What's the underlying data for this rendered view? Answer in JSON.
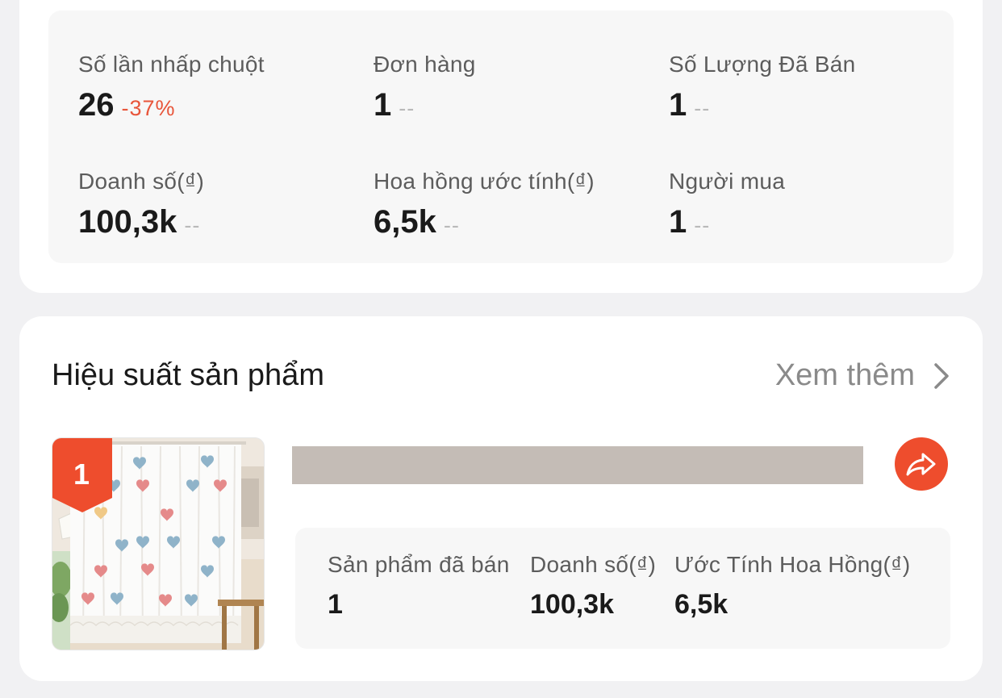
{
  "stats": [
    {
      "label": "Số lần nhấp chuột",
      "value": "26",
      "change": "-37%"
    },
    {
      "label": "Đơn hàng",
      "value": "1",
      "change": "--"
    },
    {
      "label": "Số Lượng Đã Bán",
      "value": "1",
      "change": "--"
    },
    {
      "label": "Doanh số(₫)",
      "value": "100,3k",
      "change": "--"
    },
    {
      "label": "Hoa hồng ước tính(₫)",
      "value": "6,5k",
      "change": "--"
    },
    {
      "label": "Người mua",
      "value": "1",
      "change": "--"
    }
  ],
  "product_section": {
    "title": "Hiệu suất sản phẩm",
    "see_more": "Xem thêm",
    "see_more_icon": "chevron-right-icon",
    "product": {
      "rank": "1",
      "share_icon": "share-icon",
      "metrics": [
        {
          "label": "Sản phẩm đã bán",
          "value": "1"
        },
        {
          "label": "Doanh số(₫)",
          "value": "100,3k"
        },
        {
          "label": "Ước Tính Hoa Hồng(₫)",
          "value": "6,5k"
        }
      ]
    }
  },
  "colors": {
    "accent": "#ee4d2d",
    "negative_change": "#e8553a",
    "background": "#f1f1f3",
    "card": "#ffffff",
    "panel": "#f7f7f7"
  }
}
